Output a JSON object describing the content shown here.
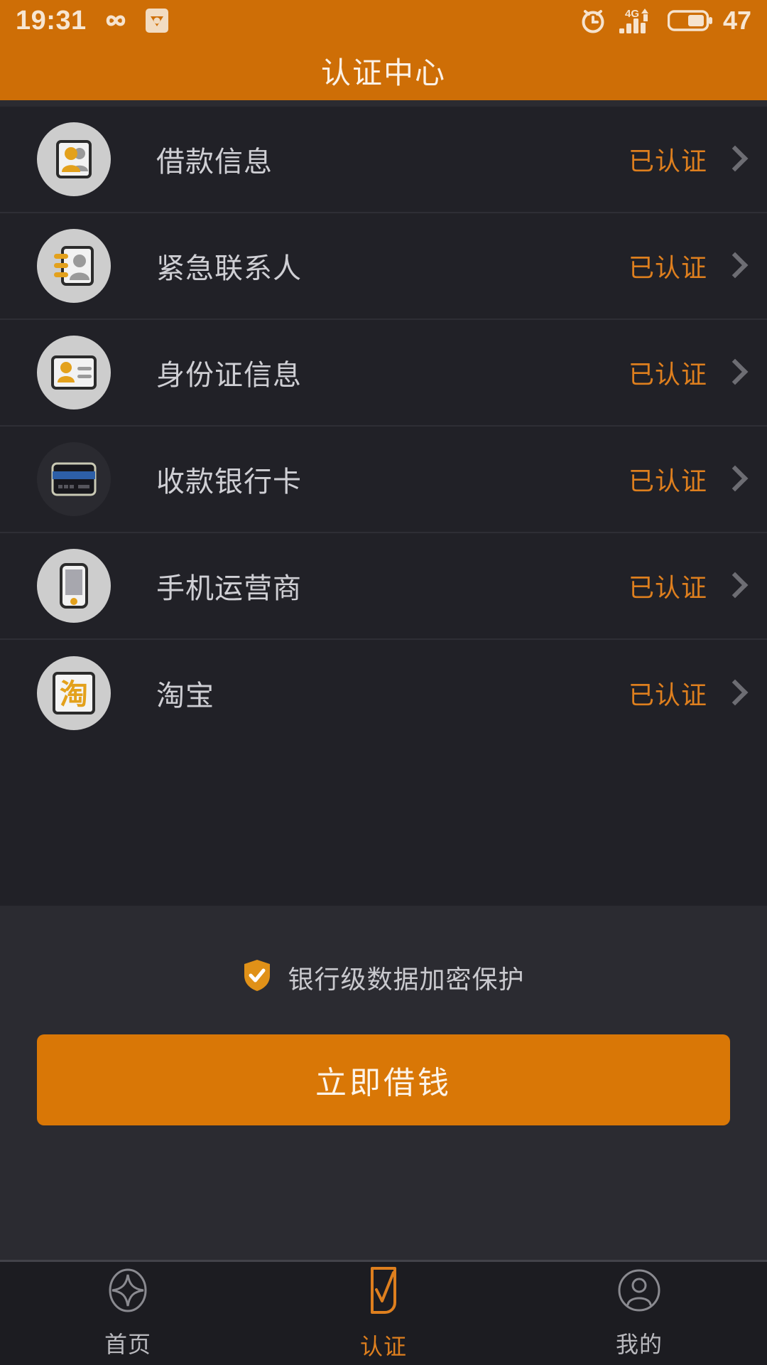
{
  "statusbar": {
    "time": "19:31",
    "battery_percent": "47",
    "network_type": "4G",
    "icons": [
      "infinity-icon",
      "app-badge-icon",
      "alarm-clock-icon",
      "signal-bars-icon",
      "battery-icon"
    ]
  },
  "header": {
    "title": "认证中心"
  },
  "list": {
    "rows": [
      {
        "label": "借款信息",
        "status": "已认证",
        "icon": "id-card-people-icon",
        "icon_style": "light"
      },
      {
        "label": "紧急联系人",
        "status": "已认证",
        "icon": "contact-book-icon",
        "icon_style": "light"
      },
      {
        "label": "身份证信息",
        "status": "已认证",
        "icon": "identity-card-icon",
        "icon_style": "light"
      },
      {
        "label": "收款银行卡",
        "status": "已认证",
        "icon": "bank-card-icon",
        "icon_style": "dark"
      },
      {
        "label": "手机运营商",
        "status": "已认证",
        "icon": "mobile-phone-icon",
        "icon_style": "light"
      },
      {
        "label": "淘宝",
        "status": "已认证",
        "icon": "taobao-logo-icon",
        "icon_style": "light"
      }
    ]
  },
  "footer": {
    "secure_note": "银行级数据加密保护",
    "secure_icon": "shield-check-icon",
    "cta_label": "立即借钱"
  },
  "tabbar": {
    "tabs": [
      {
        "label": "首页",
        "icon": "home-diamond-icon",
        "active": false
      },
      {
        "label": "认证",
        "icon": "verify-check-icon",
        "active": true
      },
      {
        "label": "我的",
        "icon": "person-circle-icon",
        "active": false
      }
    ]
  },
  "colors": {
    "brand_orange": "#CE6E06",
    "accent_orange": "#DE7F1E",
    "cta_orange": "#D97706",
    "list_bg": "#212127",
    "panel_bg": "#2B2B31",
    "tabbar_bg": "#1C1C21"
  }
}
